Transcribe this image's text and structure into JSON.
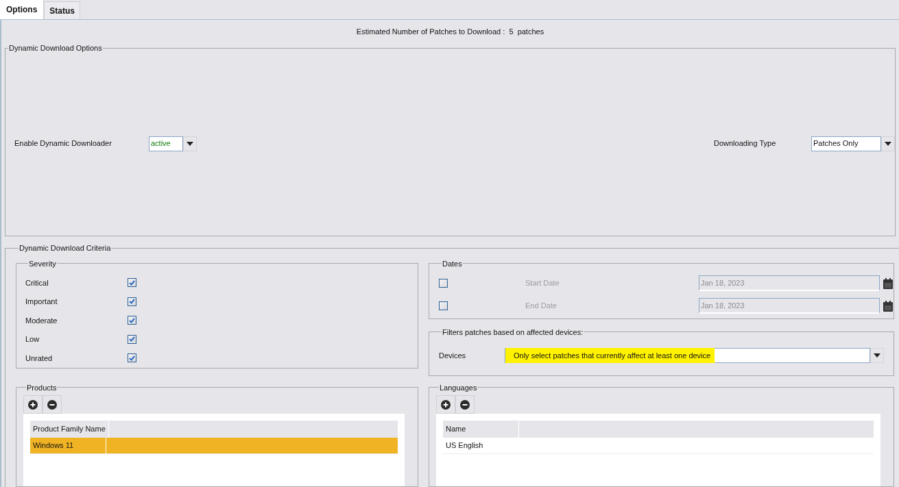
{
  "tabs": [
    {
      "label": "Options",
      "selected": true
    },
    {
      "label": "Status",
      "selected": false
    }
  ],
  "estimate": "Estimated Number of Patches to Download :  5  patches",
  "download_options": {
    "title": "Dynamic Download Options",
    "enable": {
      "label": "Enable Dynamic Downloader",
      "value": "active"
    },
    "type": {
      "label": "Downloading Type",
      "value": "Patches Only"
    }
  },
  "criteria": {
    "title": "Dynamic Download Criteria",
    "severity": {
      "title": "Severity",
      "items": [
        {
          "label": "Critical",
          "checked": true
        },
        {
          "label": "Important",
          "checked": true
        },
        {
          "label": "Moderate",
          "checked": true
        },
        {
          "label": "Low",
          "checked": true
        },
        {
          "label": "Unrated",
          "checked": true
        }
      ]
    },
    "dates": {
      "title": "Dates",
      "rows": [
        {
          "checked": false,
          "label": "Start Date",
          "value": "Jan 18, 2023",
          "disabled": true
        },
        {
          "checked": false,
          "label": "End Date",
          "value": "Jan 18, 2023",
          "disabled": true
        }
      ]
    },
    "device_filter": {
      "title": "Filters patches based on affected devices:",
      "label": "Devices",
      "value": "Only select patches that currently affect at least one device",
      "highlighted": true
    },
    "products": {
      "title": "Products",
      "columns": [
        "Product Family Name"
      ],
      "rows": [
        {
          "cells": [
            "Windows 11"
          ],
          "selected": true
        }
      ]
    },
    "languages": {
      "title": "Languages",
      "columns": [
        "Name"
      ],
      "rows": [
        {
          "cells": [
            "US English"
          ],
          "selected": false
        }
      ]
    }
  }
}
